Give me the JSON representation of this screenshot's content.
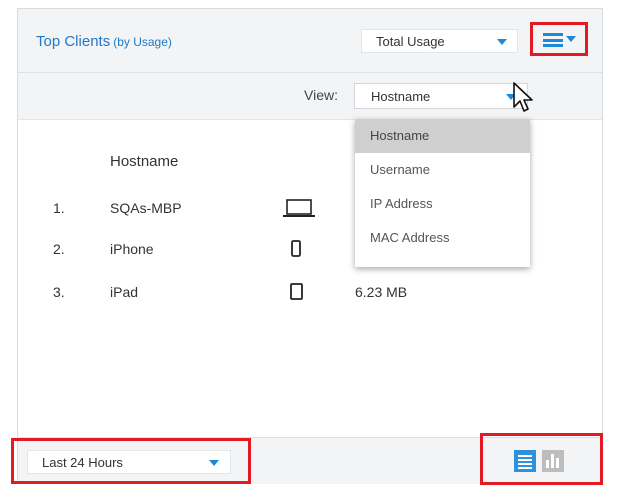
{
  "widget": {
    "title": "Top Clients",
    "title_sub": "(by Usage)",
    "metric_select": "Total Usage",
    "view_label": "View:",
    "view_select": "Hostname",
    "column_header": "Hostname",
    "clients": [
      {
        "rank": "1.",
        "name": "SQAs-MBP",
        "device": "laptop",
        "usage": ""
      },
      {
        "rank": "2.",
        "name": "iPhone",
        "device": "phone",
        "usage": ""
      },
      {
        "rank": "3.",
        "name": "iPad",
        "device": "tablet",
        "usage": "6.23 MB"
      }
    ],
    "view_options": [
      "Hostname",
      "Username",
      "IP Address",
      "MAC Address"
    ],
    "selected_view_option": "Hostname",
    "time_range": "Last 24 Hours"
  },
  "colors": {
    "accent": "#1e88d8",
    "highlight_box": "#e11b22",
    "header_bg": "#f3f4f5"
  },
  "icons": [
    "hamburger-menu-icon",
    "dropdown-arrow-icon",
    "laptop-icon",
    "phone-icon",
    "tablet-icon",
    "table-view-icon",
    "chart-view-icon",
    "mouse-cursor-icon"
  ]
}
